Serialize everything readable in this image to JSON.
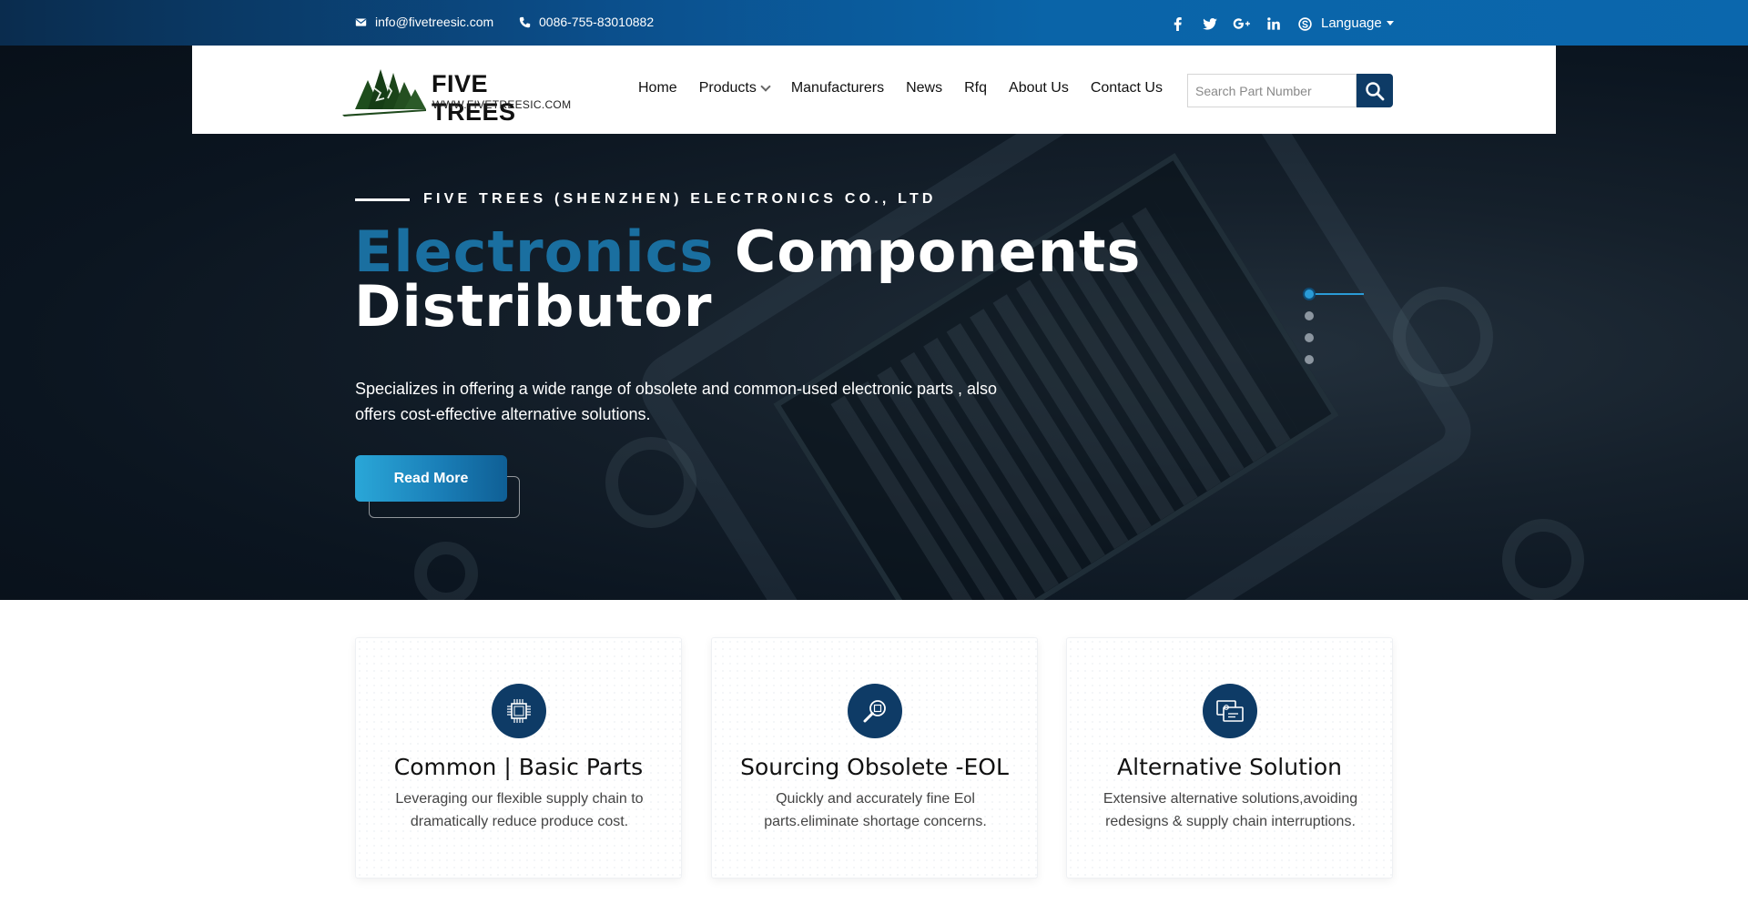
{
  "topbar": {
    "email": "info@fivetreesic.com",
    "phone": "0086-755-83010882",
    "socials": [
      "facebook-icon",
      "twitter-icon",
      "google-plus-icon",
      "linkedin-icon",
      "skype-icon"
    ],
    "language_label": "Language"
  },
  "logo": {
    "wordmark": "FIVE TREES",
    "url_text": "WWW.FIVETREESIC.COM"
  },
  "nav": {
    "items": [
      {
        "label": "Home"
      },
      {
        "label": "Products",
        "has_dropdown": true
      },
      {
        "label": "Manufacturers"
      },
      {
        "label": "News"
      },
      {
        "label": "Rfq"
      },
      {
        "label": "About Us"
      },
      {
        "label": "Contact Us"
      }
    ]
  },
  "search": {
    "placeholder": "Search Part Number",
    "value": ""
  },
  "hero": {
    "eyebrow": "FIVE TREES (SHENZHEN) ELECTRONICS CO., LTD",
    "headline_accent": "Electronics",
    "headline_rest": " Components",
    "headline_line2": "Distributor",
    "lead": "Specializes in offering a wide range of obsolete and common-used electronic parts , also offers cost-effective alternative solutions.",
    "cta_label": "Read More",
    "slider_count": 4,
    "slider_active": 1
  },
  "features": [
    {
      "icon": "chip-icon",
      "title": "Common | Basic Parts",
      "text": "Leveraging our flexible supply chain to dramatically reduce produce cost."
    },
    {
      "icon": "magnifier-chip-icon",
      "title": "Sourcing Obsolete -EOL",
      "text": "Quickly and accurately fine Eol parts.eliminate shortage concerns."
    },
    {
      "icon": "cards-icon",
      "title": "Alternative Solution",
      "text": "Extensive alternative solutions,avoiding redesigns & supply chain interruptions."
    }
  ],
  "colors": {
    "brand_navy": "#0e3b66",
    "accent_blue": "#1a6fa0",
    "cta_light": "#2aa7d8",
    "topbar_blue": "#0b67ad"
  }
}
